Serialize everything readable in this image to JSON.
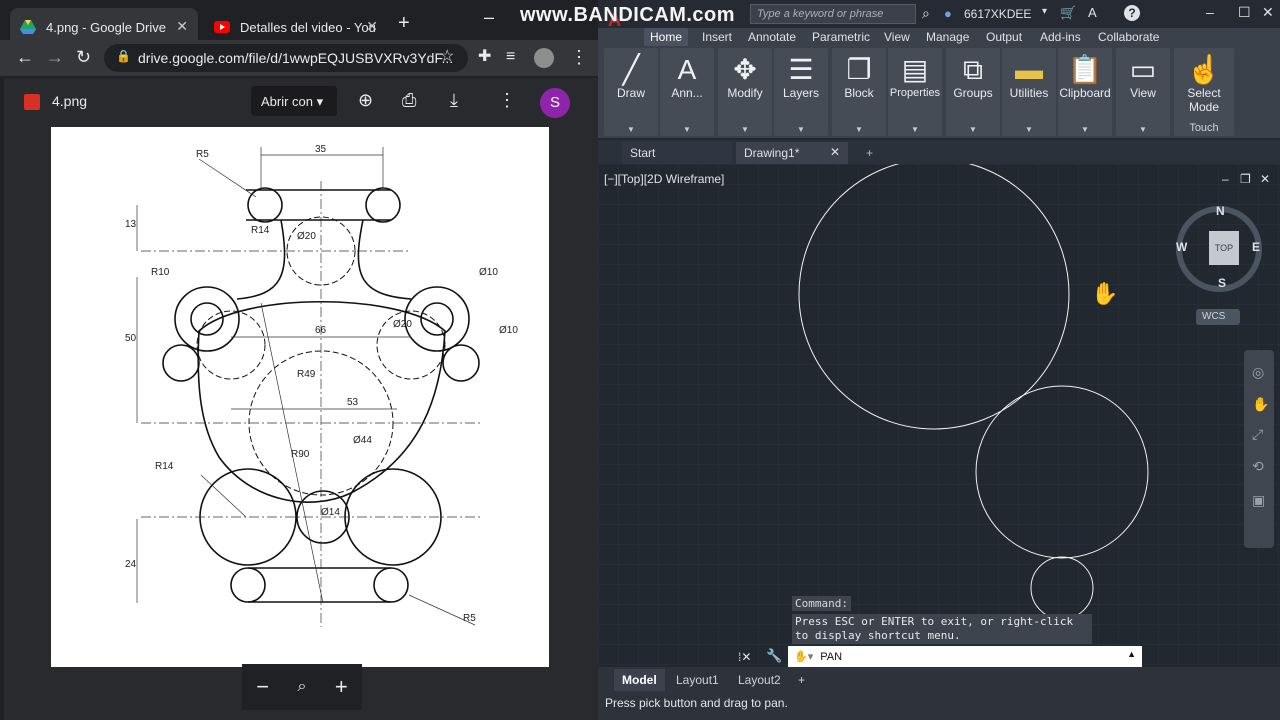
{
  "watermark": "www.BANDICAM.com",
  "browser": {
    "tabs": [
      {
        "title": "4.png - Google Drive",
        "icon": "google-drive-icon"
      },
      {
        "title": "Detalles del video - YouTube",
        "icon": "youtube-icon"
      }
    ],
    "url": "drive.google.com/file/d/1wwpEQJUSBVXRv3YdF..."
  },
  "drive": {
    "file_name": "4.png",
    "open_with": "Abrir con",
    "avatar_letter": "S",
    "zoom_minus": "−",
    "zoom_plus": "+"
  },
  "drawing": {
    "labels": [
      "R5",
      "35",
      "13",
      "R14",
      "Ø20",
      "R10",
      "Ø10",
      "Ø10",
      "50",
      "66",
      "Ø20",
      "R49",
      "53",
      "Ø44",
      "R90",
      "R14",
      "Ø14",
      "24",
      "R5"
    ]
  },
  "autocad": {
    "search_placeholder": "Type a keyword or phrase",
    "user": "6617XKDEE",
    "menu": [
      "Home",
      "Insert",
      "Annotate",
      "Parametric",
      "View",
      "Manage",
      "Output",
      "Add-ins",
      "Collaborate"
    ],
    "ribbon": [
      {
        "label": "Draw",
        "icon": "draw-line-icon"
      },
      {
        "label": "Ann...",
        "icon": "annotation-text-icon"
      },
      {
        "label": "Modify",
        "icon": "move-arrows-icon"
      },
      {
        "label": "Layers",
        "icon": "layers-icon"
      },
      {
        "label": "Block",
        "icon": "block-icon"
      },
      {
        "label": "Properties",
        "icon": "properties-icon"
      },
      {
        "label": "Groups",
        "icon": "groups-icon"
      },
      {
        "label": "Utilities",
        "icon": "ruler-icon"
      },
      {
        "label": "Clipboard",
        "icon": "clipboard-icon"
      },
      {
        "label": "View",
        "icon": "view-icon"
      }
    ],
    "touch": {
      "line1": "Select",
      "line2": "Mode",
      "group": "Touch"
    },
    "doc_tabs": [
      "Start",
      "Drawing1*"
    ],
    "viewport_label": "[−][Top][2D Wireframe]",
    "viewcube": {
      "n": "N",
      "s": "S",
      "e": "E",
      "w": "W",
      "face": "TOP",
      "wcs": "WCS"
    },
    "command_label": "Command:",
    "command_msg": "Press ESC or ENTER to exit, or right-click to display shortcut menu.",
    "command_input": "PAN",
    "layout_tabs": [
      "Model",
      "Layout1",
      "Layout2"
    ],
    "status_text": "Press pick button and drag to pan."
  }
}
